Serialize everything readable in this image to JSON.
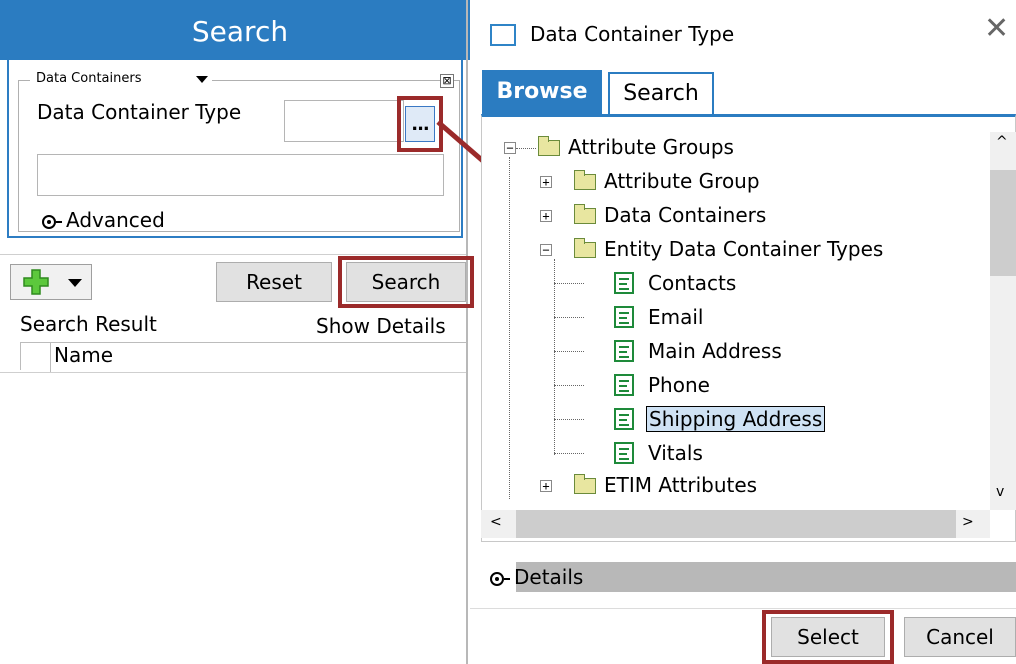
{
  "left_panel": {
    "title": "Search",
    "container_dropdown": "Data Containers",
    "close_glyph": "⊠",
    "dct_label": "Data Container Type",
    "browse_button_label": "...",
    "advanced_label": "Advanced",
    "reset_label": "Reset",
    "search_label": "Search",
    "search_result_label": "Search Result",
    "show_details_label": "Show Details",
    "name_column": "Name"
  },
  "dialog": {
    "title": "Data Container Type",
    "close_glyph": "✕",
    "tabs": [
      {
        "label": "Browse",
        "active": true
      },
      {
        "label": "Search",
        "active": false
      }
    ],
    "tree": [
      {
        "label": "Attribute Groups",
        "expander": "−",
        "icon": "folder-icon"
      },
      {
        "label": "Attribute Group",
        "expander": "+",
        "icon": "folder-icon"
      },
      {
        "label": "Data Containers",
        "expander": "+",
        "icon": "folder-icon"
      },
      {
        "label": "Entity Data Container Types",
        "expander": "−",
        "icon": "folder-icon"
      },
      {
        "label": "Contacts",
        "icon": "document-icon"
      },
      {
        "label": "Email",
        "icon": "document-icon"
      },
      {
        "label": "Main Address",
        "icon": "document-icon"
      },
      {
        "label": "Phone",
        "icon": "document-icon"
      },
      {
        "label": "Shipping Address",
        "icon": "document-icon",
        "selected": true
      },
      {
        "label": "Vitals",
        "icon": "document-icon"
      },
      {
        "label": "ETIM Attributes",
        "expander": "+",
        "icon": "folder-icon"
      }
    ],
    "scroll_up": "^",
    "scroll_down": "v",
    "scroll_left": "<",
    "scroll_right": ">",
    "details_label": "Details",
    "select_label": "Select",
    "cancel_label": "Cancel"
  },
  "colors": {
    "accent_blue": "#2b7cc1",
    "highlight_red": "#9b2a2a",
    "selection_bg": "#cfe2f4"
  }
}
